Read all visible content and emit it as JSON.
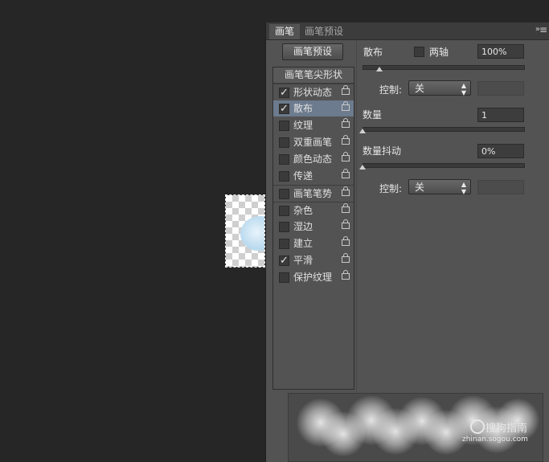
{
  "panel": {
    "tabs": [
      {
        "label": "画笔"
      },
      {
        "label": "画笔预设"
      }
    ],
    "menu_icon": "»",
    "preset_button": "画笔预设",
    "list_header": "画笔笔尖形状",
    "list_items": [
      {
        "label": "形状动态",
        "checked": "✓"
      },
      {
        "label": "散布",
        "checked": "✓"
      },
      {
        "label": "纹理",
        "checked": ""
      },
      {
        "label": "双重画笔",
        "checked": ""
      },
      {
        "label": "颜色动态",
        "checked": ""
      },
      {
        "label": "传递",
        "checked": ""
      },
      {
        "label": "画笔笔势",
        "checked": ""
      },
      {
        "label": "杂色",
        "checked": ""
      },
      {
        "label": "湿边",
        "checked": ""
      },
      {
        "label": "建立",
        "checked": ""
      },
      {
        "label": "平滑",
        "checked": "✓"
      },
      {
        "label": "保护纹理",
        "checked": ""
      }
    ]
  },
  "scatter": {
    "label": "散布",
    "both_axes_label": "两轴",
    "value": "100%",
    "control_label": "控制:",
    "control_value": "关",
    "count_label": "数量",
    "count_value": "1",
    "count_jitter_label": "数量抖动",
    "count_jitter_value": "0%",
    "control2_label": "控制:",
    "control2_value": "关"
  },
  "watermark": {
    "text": "搜狗指南",
    "url": "zhinan.sogou.com"
  }
}
